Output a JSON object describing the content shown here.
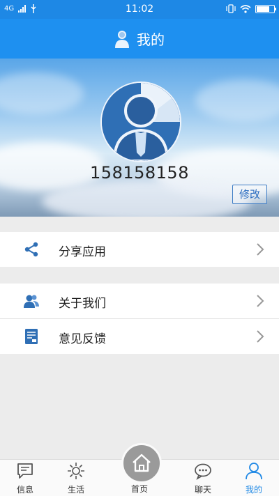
{
  "status_bar": {
    "network": "4G",
    "time": "11:02",
    "icons": [
      "signal-icon",
      "usb-icon",
      "vibrate-icon",
      "wifi-icon",
      "battery-icon"
    ],
    "battery_level": 0.8
  },
  "header": {
    "title": "我的",
    "icon": "user-icon"
  },
  "profile": {
    "avatar_icon": "avatar-icon",
    "phone": "158158158",
    "edit_label": "修改"
  },
  "menu": [
    {
      "label": "分享应用",
      "icon": "share-icon"
    },
    {
      "label": "关于我们",
      "icon": "users-icon"
    },
    {
      "label": "意见反馈",
      "icon": "feedback-icon"
    }
  ],
  "tabbar": {
    "items": [
      {
        "label": "信息",
        "icon": "message-icon",
        "active": false
      },
      {
        "label": "生活",
        "icon": "life-icon",
        "active": false
      },
      {
        "label": "首页",
        "icon": "home-icon",
        "active": false
      },
      {
        "label": "聊天",
        "icon": "chat-icon",
        "active": false
      },
      {
        "label": "我的",
        "icon": "user-icon",
        "active": true
      }
    ],
    "active_color": "#1e88e5"
  },
  "colors": {
    "primary": "#1e88e5",
    "icon_blue": "#2f6fb5"
  }
}
